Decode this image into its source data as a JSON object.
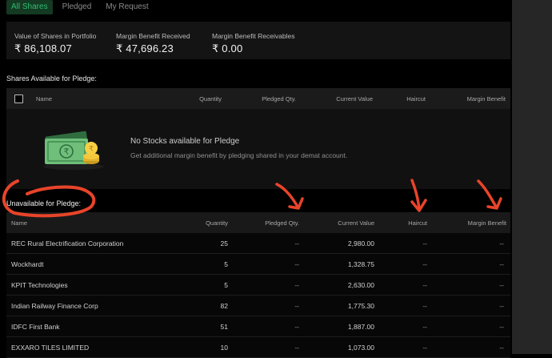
{
  "tabs": [
    {
      "label": "All Shares"
    },
    {
      "label": "Pledged"
    },
    {
      "label": "My Request"
    }
  ],
  "summary": {
    "portfolio_label": "Value of Shares in Portfolio",
    "portfolio_value": "₹ 86,108.07",
    "received_label": "Margin Benefit Received",
    "received_value": "₹ 47,696.23",
    "receivable_label": "Margin Benefit Receivables",
    "receivable_value": "₹ 0.00"
  },
  "available": {
    "title": "Shares Available for Pledge:",
    "columns": [
      "Name",
      "Quantity",
      "Pledged Qty.",
      "Current Value",
      "Haircut",
      "Margin Benefit"
    ],
    "empty_title": "No Stocks available for Pledge",
    "empty_subtitle": "Get additional margin benefit by pledging shared in your demat account."
  },
  "unavailable": {
    "title": "Unavailable for Pledge:",
    "columns": [
      "Name",
      "Quantity",
      "Pledged Qty.",
      "Current Value",
      "Haircut",
      "Margin Benefit"
    ],
    "rows": [
      {
        "name": "REC Rural Electrification Corporation",
        "qty": "25",
        "pledged": "--",
        "value": "2,980.00",
        "haircut": "--",
        "benefit": "--"
      },
      {
        "name": "Wockhardt",
        "qty": "5",
        "pledged": "--",
        "value": "1,328.75",
        "haircut": "--",
        "benefit": "--"
      },
      {
        "name": "KPIT Technologies",
        "qty": "5",
        "pledged": "--",
        "value": "2,630.00",
        "haircut": "--",
        "benefit": "--"
      },
      {
        "name": "Indian Railway Finance Corp",
        "qty": "82",
        "pledged": "--",
        "value": "1,775.30",
        "haircut": "--",
        "benefit": "--"
      },
      {
        "name": "IDFC First Bank",
        "qty": "51",
        "pledged": "--",
        "value": "1,887.00",
        "haircut": "--",
        "benefit": "--"
      },
      {
        "name": "EXXARO TILES LIMITED",
        "qty": "10",
        "pledged": "--",
        "value": "1,073.00",
        "haircut": "--",
        "benefit": "--"
      }
    ]
  },
  "colors": {
    "accent": "#2fbf71",
    "annotation": "#e8442a",
    "background": "#000000"
  },
  "icons": [
    "money-coins-illustration-icon"
  ]
}
